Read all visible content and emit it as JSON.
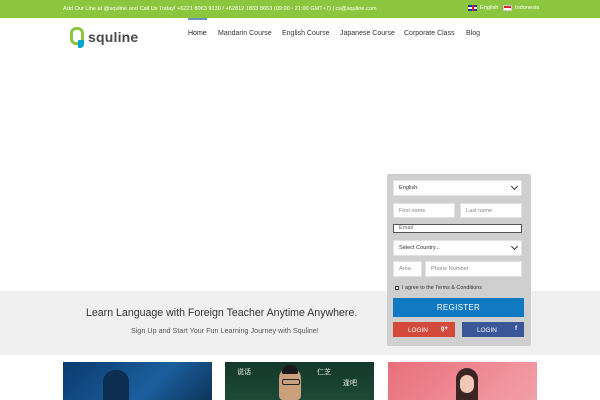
{
  "topbar": {
    "contact": "Add Our Line at @squline and Call Us Today! +6221 8063 9130 / +62812 1833 8653 (09:00 - 21:00 GMT+7)  |  cs@squline.com",
    "lang_en": "English",
    "lang_id": "Indonesia"
  },
  "header": {
    "logo_text": "squline",
    "nav": {
      "home": "Home",
      "mandarin": "Mandarin Course",
      "english": "English Course",
      "japanese": "Japanese Course",
      "corporate": "Corporate Class",
      "blog": "Blog"
    }
  },
  "band": {
    "title": "Learn Language with Foreign Teacher Anytime Anywhere.",
    "subtitle": "Sign Up and Start Your Fun Learning Journey with Squline!"
  },
  "form": {
    "language_selected": "English",
    "first_name_placeholder": "First name",
    "last_name_placeholder": "Last name",
    "email_placeholder": "Email",
    "country_selected": "Select Country...",
    "area_placeholder": "Area",
    "phone_placeholder": "Phone Number",
    "agree_label": "I agree to the Terms & Conditions",
    "register_label": "REGISTER",
    "google_login_label": "LOGIN",
    "google_icon": "g+",
    "facebook_login_label": "LOGIN",
    "facebook_icon": "f"
  },
  "colors": {
    "topbar": "#8cc63f",
    "register": "#1179c1",
    "google": "#d34a3d",
    "facebook": "#3a5897"
  },
  "cards": {
    "chalk_1": "说话",
    "chalk_2": "仁芝",
    "chalk_3": "逢吧"
  }
}
